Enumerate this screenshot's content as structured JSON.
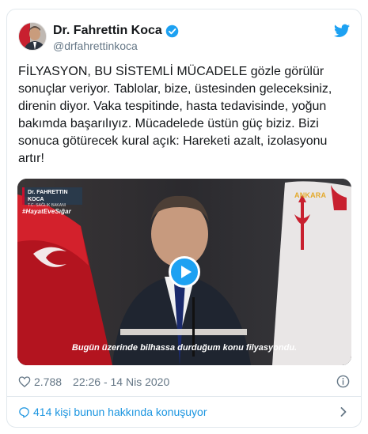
{
  "author": {
    "display_name": "Dr. Fahrettin Koca",
    "handle": "@drfahrettinkoca",
    "verified": true
  },
  "tweet": {
    "text": "FİLYASYON, BU SİSTEMLİ MÜCADELE gözle görülür sonuçlar veriyor. Tablolar, bize, üstesinden geleceksiniz, direnin diyor. Vaka tespitinde, hasta tedavisinde, yoğun bakımda başarılıyız. Mücadelede üstün güç biziz. Bizi sonuca götürecek kural açık: Hareketi azalt, izolasyonu artır!",
    "likes": "2.788",
    "timestamp": "22:26 - 14 Nis 2020"
  },
  "media": {
    "overlay_logo_name": "Dr. FAHRETTIN KOCA",
    "overlay_logo_sub": "T.C. SAĞLIK BAKANI",
    "hashtag": "#HayatEveSığar",
    "emblem_text": "ANKARA",
    "caption": "Bugün üzerinde bilhassa durduğum konu filyasyondu."
  },
  "footer": {
    "conversation_text": "414 kişi bunun hakkında konuşuyor"
  },
  "colors": {
    "accent": "#1da1f2",
    "link": "#1b95e0",
    "secondary_text": "#657786",
    "flag_red": "#d3212c"
  },
  "icons": {
    "verified": "verified-badge-icon",
    "brand": "twitter-bird-icon",
    "like": "heart-icon",
    "info": "info-icon",
    "reply": "reply-bubble-icon",
    "play": "play-icon",
    "chevron": "chevron-right-icon"
  }
}
